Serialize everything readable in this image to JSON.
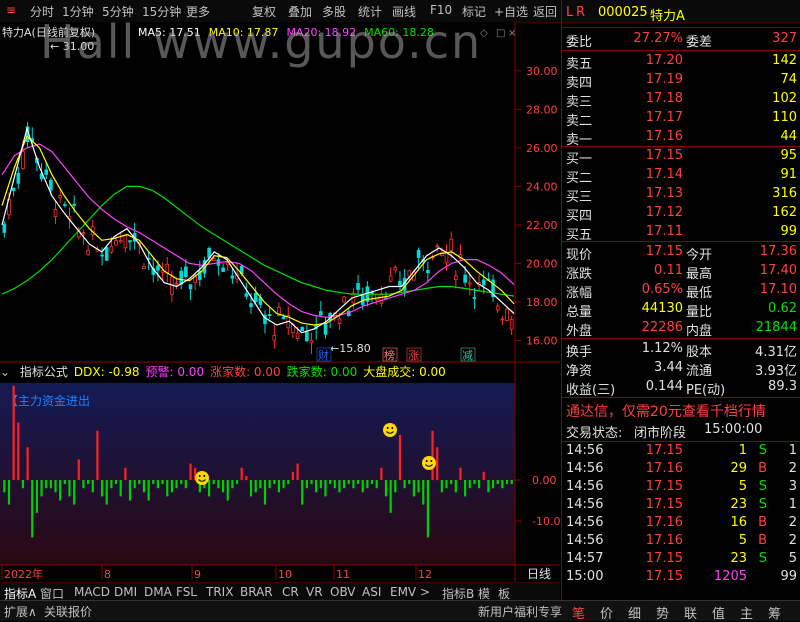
{
  "toolbar": {
    "items": [
      "分时",
      "1分钟",
      "5分钟",
      "15分钟",
      "更多",
      "复权",
      "叠加",
      "多股",
      "统计",
      "画线",
      "F10",
      "标记",
      "+自选",
      "返回"
    ]
  },
  "stock": {
    "code": "000025",
    "name": "特力A",
    "chart_title": "特力A(日线前复权)",
    "lr_badge": "L R"
  },
  "ma_legend": [
    {
      "label": "MA5: 17.51",
      "color": "#ffffff"
    },
    {
      "label": "MA10: 17.87",
      "color": "#ffff00"
    },
    {
      "label": "MA20: 18.92",
      "color": "#ff40ff"
    },
    {
      "label": "MA60: 18.28",
      "color": "#00e000"
    }
  ],
  "annotations": {
    "high": "31.00",
    "low": "15.80",
    "events": [
      "财",
      "榜",
      "涨",
      "减"
    ]
  },
  "indicator": {
    "title_items": [
      {
        "label": "指标公式",
        "color": "#e0e0e0"
      },
      {
        "label": "DDX: -0.98",
        "color": "#ffff00"
      },
      {
        "label": "预警: 0.00",
        "color": "#ff40ff"
      },
      {
        "label": "涨家数: 0.00",
        "color": "#ff4040"
      },
      {
        "label": "跌家数: 0.00",
        "color": "#00e000"
      },
      {
        "label": "大盘成交: 0.00",
        "color": "#ffff00"
      }
    ],
    "label": "【主力资金进出"
  },
  "chart_data": {
    "type": "bar",
    "price_axis": {
      "ticks": [
        "30.00",
        "28.00",
        "26.00",
        "24.00",
        "22.00",
        "20.00",
        "18.00",
        "16.00"
      ],
      "ylim": [
        15.4,
        31.6
      ]
    },
    "ind_axis": {
      "ticks": [
        "0.00",
        "-10.00"
      ]
    },
    "x_labels": [
      "2022年",
      "8",
      "9",
      "10",
      "11",
      "12"
    ],
    "ma5": [
      22.0,
      24.5,
      27.0,
      25.0,
      23.5,
      22.6,
      21.8,
      21.0,
      20.6,
      21.4,
      21.8,
      21.0,
      19.8,
      19.0,
      18.8,
      19.2,
      19.8,
      20.6,
      20.2,
      19.2,
      18.2,
      17.2,
      16.8,
      17.0,
      16.4,
      16.6,
      17.0,
      17.6,
      18.2,
      18.4,
      18.6,
      18.8,
      18.8,
      19.6,
      20.4,
      20.8,
      20.4,
      19.8,
      19.0,
      18.6,
      18.0,
      17.4
    ],
    "ma10": [
      23.0,
      25.0,
      26.6,
      26.0,
      24.6,
      23.5,
      22.6,
      21.8,
      21.2,
      21.3,
      21.5,
      21.2,
      20.4,
      19.6,
      19.2,
      19.1,
      19.6,
      20.4,
      20.3,
      19.6,
      18.8,
      18.0,
      17.4,
      17.2,
      16.9,
      16.8,
      16.9,
      17.3,
      17.8,
      18.1,
      18.2,
      18.3,
      18.6,
      19.4,
      20.2,
      20.5,
      20.6,
      20.2,
      19.6,
      19.1,
      18.6,
      17.9
    ],
    "ma20": [
      24.6,
      25.6,
      26.0,
      26.2,
      25.8,
      25.0,
      24.2,
      23.4,
      22.8,
      22.3,
      21.9,
      21.6,
      21.2,
      20.8,
      20.4,
      20.0,
      19.9,
      20.0,
      20.1,
      20.0,
      19.6,
      19.0,
      18.4,
      17.9,
      17.5,
      17.3,
      17.2,
      17.3,
      17.5,
      17.8,
      18.0,
      18.2,
      18.4,
      18.6,
      19.0,
      19.6,
      20.0,
      20.2,
      20.2,
      19.9,
      19.5,
      18.9
    ],
    "ma60": [
      18.4,
      18.7,
      19.1,
      19.6,
      20.2,
      20.9,
      21.6,
      22.3,
      23.0,
      23.6,
      24.0,
      24.0,
      23.8,
      23.4,
      22.9,
      22.4,
      21.9,
      21.5,
      21.1,
      20.7,
      20.3,
      19.9,
      19.6,
      19.3,
      19.0,
      18.8,
      18.6,
      18.5,
      18.4,
      18.4,
      18.4,
      18.4,
      18.5,
      18.6,
      18.7,
      18.8,
      18.8,
      18.7,
      18.6,
      18.5,
      18.4,
      18.3
    ],
    "ddx": [
      -3,
      -6,
      23,
      14,
      -2,
      8,
      -14,
      -8,
      -4,
      -2,
      -2,
      -3,
      -5,
      -1,
      -4,
      -6,
      5,
      -2,
      -1,
      -3,
      12,
      -4,
      -6,
      -2,
      -1,
      -4,
      3,
      -5,
      -2,
      -1,
      -3,
      -5,
      -1,
      -2,
      -1,
      -4,
      -3,
      -2,
      -1,
      -2,
      4,
      3,
      -3,
      -2,
      -4,
      -1,
      -2,
      -3,
      -5,
      -2,
      -1,
      3,
      1,
      -4,
      -3,
      -2,
      -6,
      -2,
      -1,
      -3,
      -2,
      -1,
      2,
      4,
      -6,
      -2,
      -1,
      -3,
      -2,
      -4,
      -1,
      -2,
      -3,
      -2,
      -1,
      -2,
      -1,
      -3,
      -2,
      -1,
      -2,
      3,
      -4,
      -8,
      -3,
      11,
      -2,
      -1,
      -4,
      -3,
      -6,
      -14,
      12,
      8,
      -3,
      -2,
      -1,
      -3,
      3,
      -4,
      -2,
      -1,
      -2,
      2,
      -3,
      -2,
      -1,
      -2,
      -1,
      -1
    ]
  },
  "quote": {
    "weibi_label": "委比",
    "weibi": "27.27%",
    "weicha_label": "委差",
    "weicha": "327",
    "asks": [
      {
        "label": "卖五",
        "price": "17.20",
        "vol": "142"
      },
      {
        "label": "卖四",
        "price": "17.19",
        "vol": "74"
      },
      {
        "label": "卖三",
        "price": "17.18",
        "vol": "102"
      },
      {
        "label": "卖二",
        "price": "17.17",
        "vol": "110"
      },
      {
        "label": "卖一",
        "price": "17.16",
        "vol": "44"
      }
    ],
    "bids": [
      {
        "label": "买一",
        "price": "17.15",
        "vol": "95"
      },
      {
        "label": "买二",
        "price": "17.14",
        "vol": "91"
      },
      {
        "label": "买三",
        "price": "17.13",
        "vol": "316"
      },
      {
        "label": "买四",
        "price": "17.12",
        "vol": "162"
      },
      {
        "label": "买五",
        "price": "17.11",
        "vol": "99"
      }
    ],
    "stats": [
      {
        "l1": "现价",
        "v1": "17.15",
        "c1": "#ff4040",
        "l2": "今开",
        "v2": "17.36",
        "c2": "#ff4040"
      },
      {
        "l1": "涨跌",
        "v1": "0.11",
        "c1": "#ff4040",
        "l2": "最高",
        "v2": "17.40",
        "c2": "#ff4040"
      },
      {
        "l1": "涨幅",
        "v1": "0.65%",
        "c1": "#ff4040",
        "l2": "最低",
        "v2": "17.10",
        "c2": "#ff4040"
      },
      {
        "l1": "总量",
        "v1": "44130",
        "c1": "#ffff00",
        "l2": "量比",
        "v2": "0.62",
        "c2": "#00e000"
      },
      {
        "l1": "外盘",
        "v1": "22286",
        "c1": "#ff4040",
        "l2": "内盘",
        "v2": "21844",
        "c2": "#00e000"
      }
    ],
    "fund": [
      {
        "l1": "换手",
        "v1": "1.12%",
        "l2": "股本",
        "v2": "4.31亿"
      },
      {
        "l1": "净资",
        "v1": "3.44",
        "l2": "流通",
        "v2": "3.93亿"
      },
      {
        "l1": "收益(三)",
        "v1": "0.144",
        "l2": "PE(动)",
        "v2": "89.3"
      }
    ],
    "promo": "通达信，仅需20元查看千档行情",
    "status_label": "交易状态:",
    "status": "闭市阶段",
    "status_time": "15:00:00",
    "ticks": [
      {
        "t": "14:56",
        "p": "17.15",
        "v": "1",
        "bs": "S",
        "n": "1"
      },
      {
        "t": "14:56",
        "p": "17.16",
        "v": "29",
        "bs": "B",
        "n": "2"
      },
      {
        "t": "14:56",
        "p": "17.15",
        "v": "5",
        "bs": "S",
        "n": "3"
      },
      {
        "t": "14:56",
        "p": "17.15",
        "v": "23",
        "bs": "S",
        "n": "1"
      },
      {
        "t": "14:56",
        "p": "17.16",
        "v": "16",
        "bs": "B",
        "n": "2"
      },
      {
        "t": "14:56",
        "p": "17.16",
        "v": "5",
        "bs": "B",
        "n": "2"
      },
      {
        "t": "14:57",
        "p": "17.15",
        "v": "23",
        "bs": "S",
        "n": "5"
      },
      {
        "t": "15:00",
        "p": "17.15",
        "v": "1205",
        "bs": "",
        "n": "99"
      }
    ]
  },
  "bottom_tabs": [
    "指标A",
    "窗口",
    "MACD",
    "DMI",
    "DMA",
    "FSL",
    "TRIX",
    "BRAR",
    "CR",
    "VR",
    "OBV",
    "ASI",
    "EMV",
    ">",
    "指标B",
    "模",
    "板"
  ],
  "period_label": "日线",
  "status_left": [
    "扩展∧",
    "关联报价"
  ],
  "status_promo": "新用户福利专享",
  "right_tabs": [
    "笔",
    "价",
    "细",
    "势",
    "联",
    "值",
    "主",
    "筹"
  ],
  "watermark": "Hall   www.gupo.cn"
}
